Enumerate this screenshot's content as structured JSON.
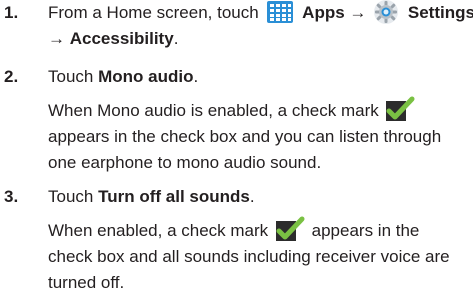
{
  "steps": [
    {
      "number": "1.",
      "lead": "From a Home screen, touch",
      "apps": "Apps",
      "arrow": "→",
      "settings": "Settings",
      "arrow2": "→",
      "accessibility": "Accessibility",
      "end": "."
    },
    {
      "number": "2.",
      "lead": "Touch",
      "target": "Mono audio",
      "end": ".",
      "desc_1a": "When Mono audio is enabled, a check mark",
      "desc_2": "appears in the check box and you can listen through",
      "desc_3": "one earphone to mono audio sound."
    },
    {
      "number": "3.",
      "lead": "Touch",
      "target": "Turn off all sounds",
      "end": ".",
      "desc_1a": "When enabled, a check mark",
      "desc_1b": "appears in the",
      "desc_2": "check box and all sounds including receiver voice are",
      "desc_3": "turned off."
    }
  ],
  "icons": {
    "apps": "apps-grid-icon",
    "settings": "settings-gear-icon",
    "check": "checkbox-checked-icon"
  },
  "colors": {
    "text": "#231f20",
    "apps_blue": "#2a8fd6",
    "check_green": "#7ac143",
    "check_box": "#2c2c2c"
  }
}
